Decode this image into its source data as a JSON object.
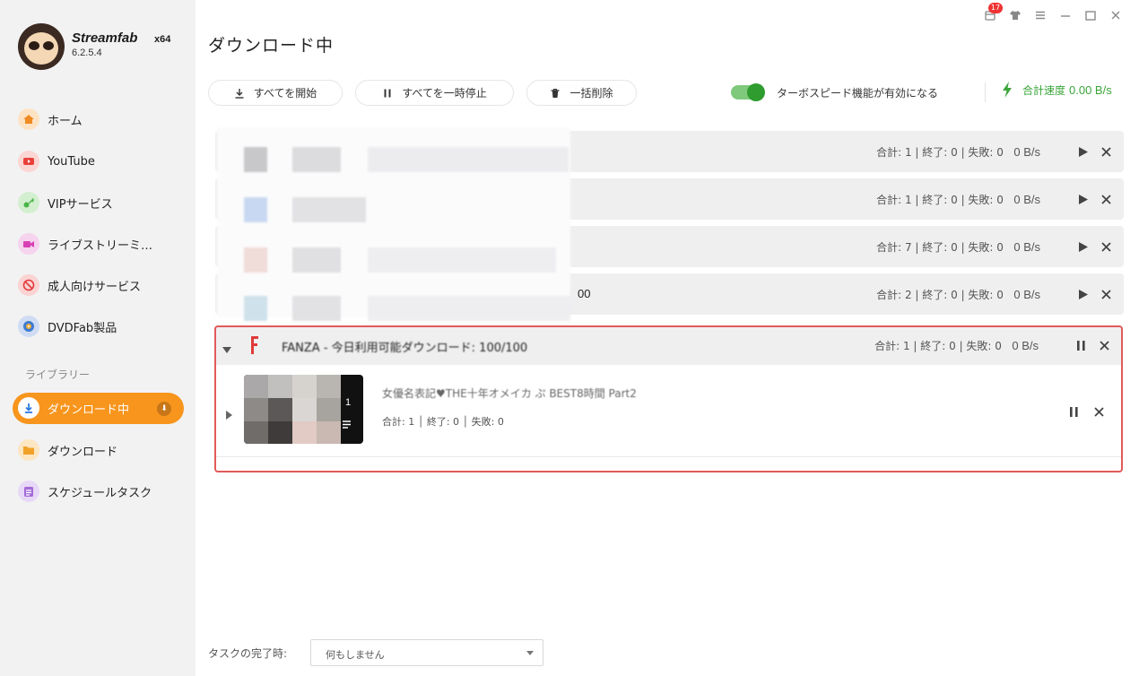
{
  "app": {
    "name": "Streamfab",
    "arch": "x64",
    "version": "6.2.5.4"
  },
  "window": {
    "notification_count": "17",
    "icons": [
      "bell-icon",
      "shirt-icon",
      "menu-icon",
      "minimize-icon",
      "maximize-icon",
      "close-icon"
    ]
  },
  "sidebar": {
    "items": [
      {
        "label": "ホーム",
        "icon": "home-icon",
        "color": "#f08a24"
      },
      {
        "label": "YouTube",
        "icon": "youtube-icon",
        "color": "#e8403a"
      },
      {
        "label": "VIPサービス",
        "icon": "key-icon",
        "color": "#49b449"
      },
      {
        "label": "ライブストリーミ…",
        "icon": "video-icon",
        "color": "#d93fb4"
      },
      {
        "label": "成人向けサービス",
        "icon": "no-adult-icon",
        "color": "#e33b3b"
      },
      {
        "label": "DVDFab製品",
        "icon": "dvdfab-icon",
        "color": "#3f7ad0"
      }
    ],
    "library_title": "ライブラリー",
    "library": [
      {
        "label": "ダウンロード中",
        "icon": "download-icon",
        "active": true,
        "badge_icon": "info-icon"
      },
      {
        "label": "ダウンロード",
        "icon": "folder-icon",
        "color": "#f0a328"
      },
      {
        "label": "スケジュールタスク",
        "icon": "schedule-icon",
        "color": "#a46bd6"
      }
    ]
  },
  "main": {
    "title": "ダウンロード中",
    "toolbar": {
      "start_all": "すべてを開始",
      "pause_all": "すべてを一時停止",
      "delete_all": "一括削除"
    },
    "turbo": {
      "label": "ターボスピード機能が有効になる",
      "enabled": true
    },
    "speed": {
      "label": "合計速度",
      "value": "0.00 B/s",
      "color": "#3aa53a"
    },
    "groups": [
      {
        "stats": "合計: 1 | 終了: 0 | 失敗: 0",
        "speed": "0 B/s",
        "visible_text": ""
      },
      {
        "stats": "合計: 1 | 終了: 0 | 失敗: 0",
        "speed": "0 B/s",
        "visible_text": ""
      },
      {
        "stats": "合計: 7 | 終了: 0 | 失敗: 0",
        "speed": "0 B/s",
        "visible_text": ""
      },
      {
        "stats": "合計: 2 | 終了: 0 | 失敗: 0",
        "speed": "0 B/s",
        "visible_text": "00"
      }
    ],
    "expanded_group": {
      "title": "FANZA - 今日利用可能ダウンロード: 100/100",
      "stats": "合計: 1 | 終了: 0 | 失敗: 0",
      "speed": "0 B/s",
      "child": {
        "title": "女優名表記♥THE十年オメイカ ぷ BEST8時間 Part2",
        "stats": "合計: 1 │ 終了: 0 │ 失敗: 0",
        "thumb_count": "1"
      }
    },
    "completion": {
      "label": "タスクの完了時:",
      "value": "何もしません"
    }
  }
}
